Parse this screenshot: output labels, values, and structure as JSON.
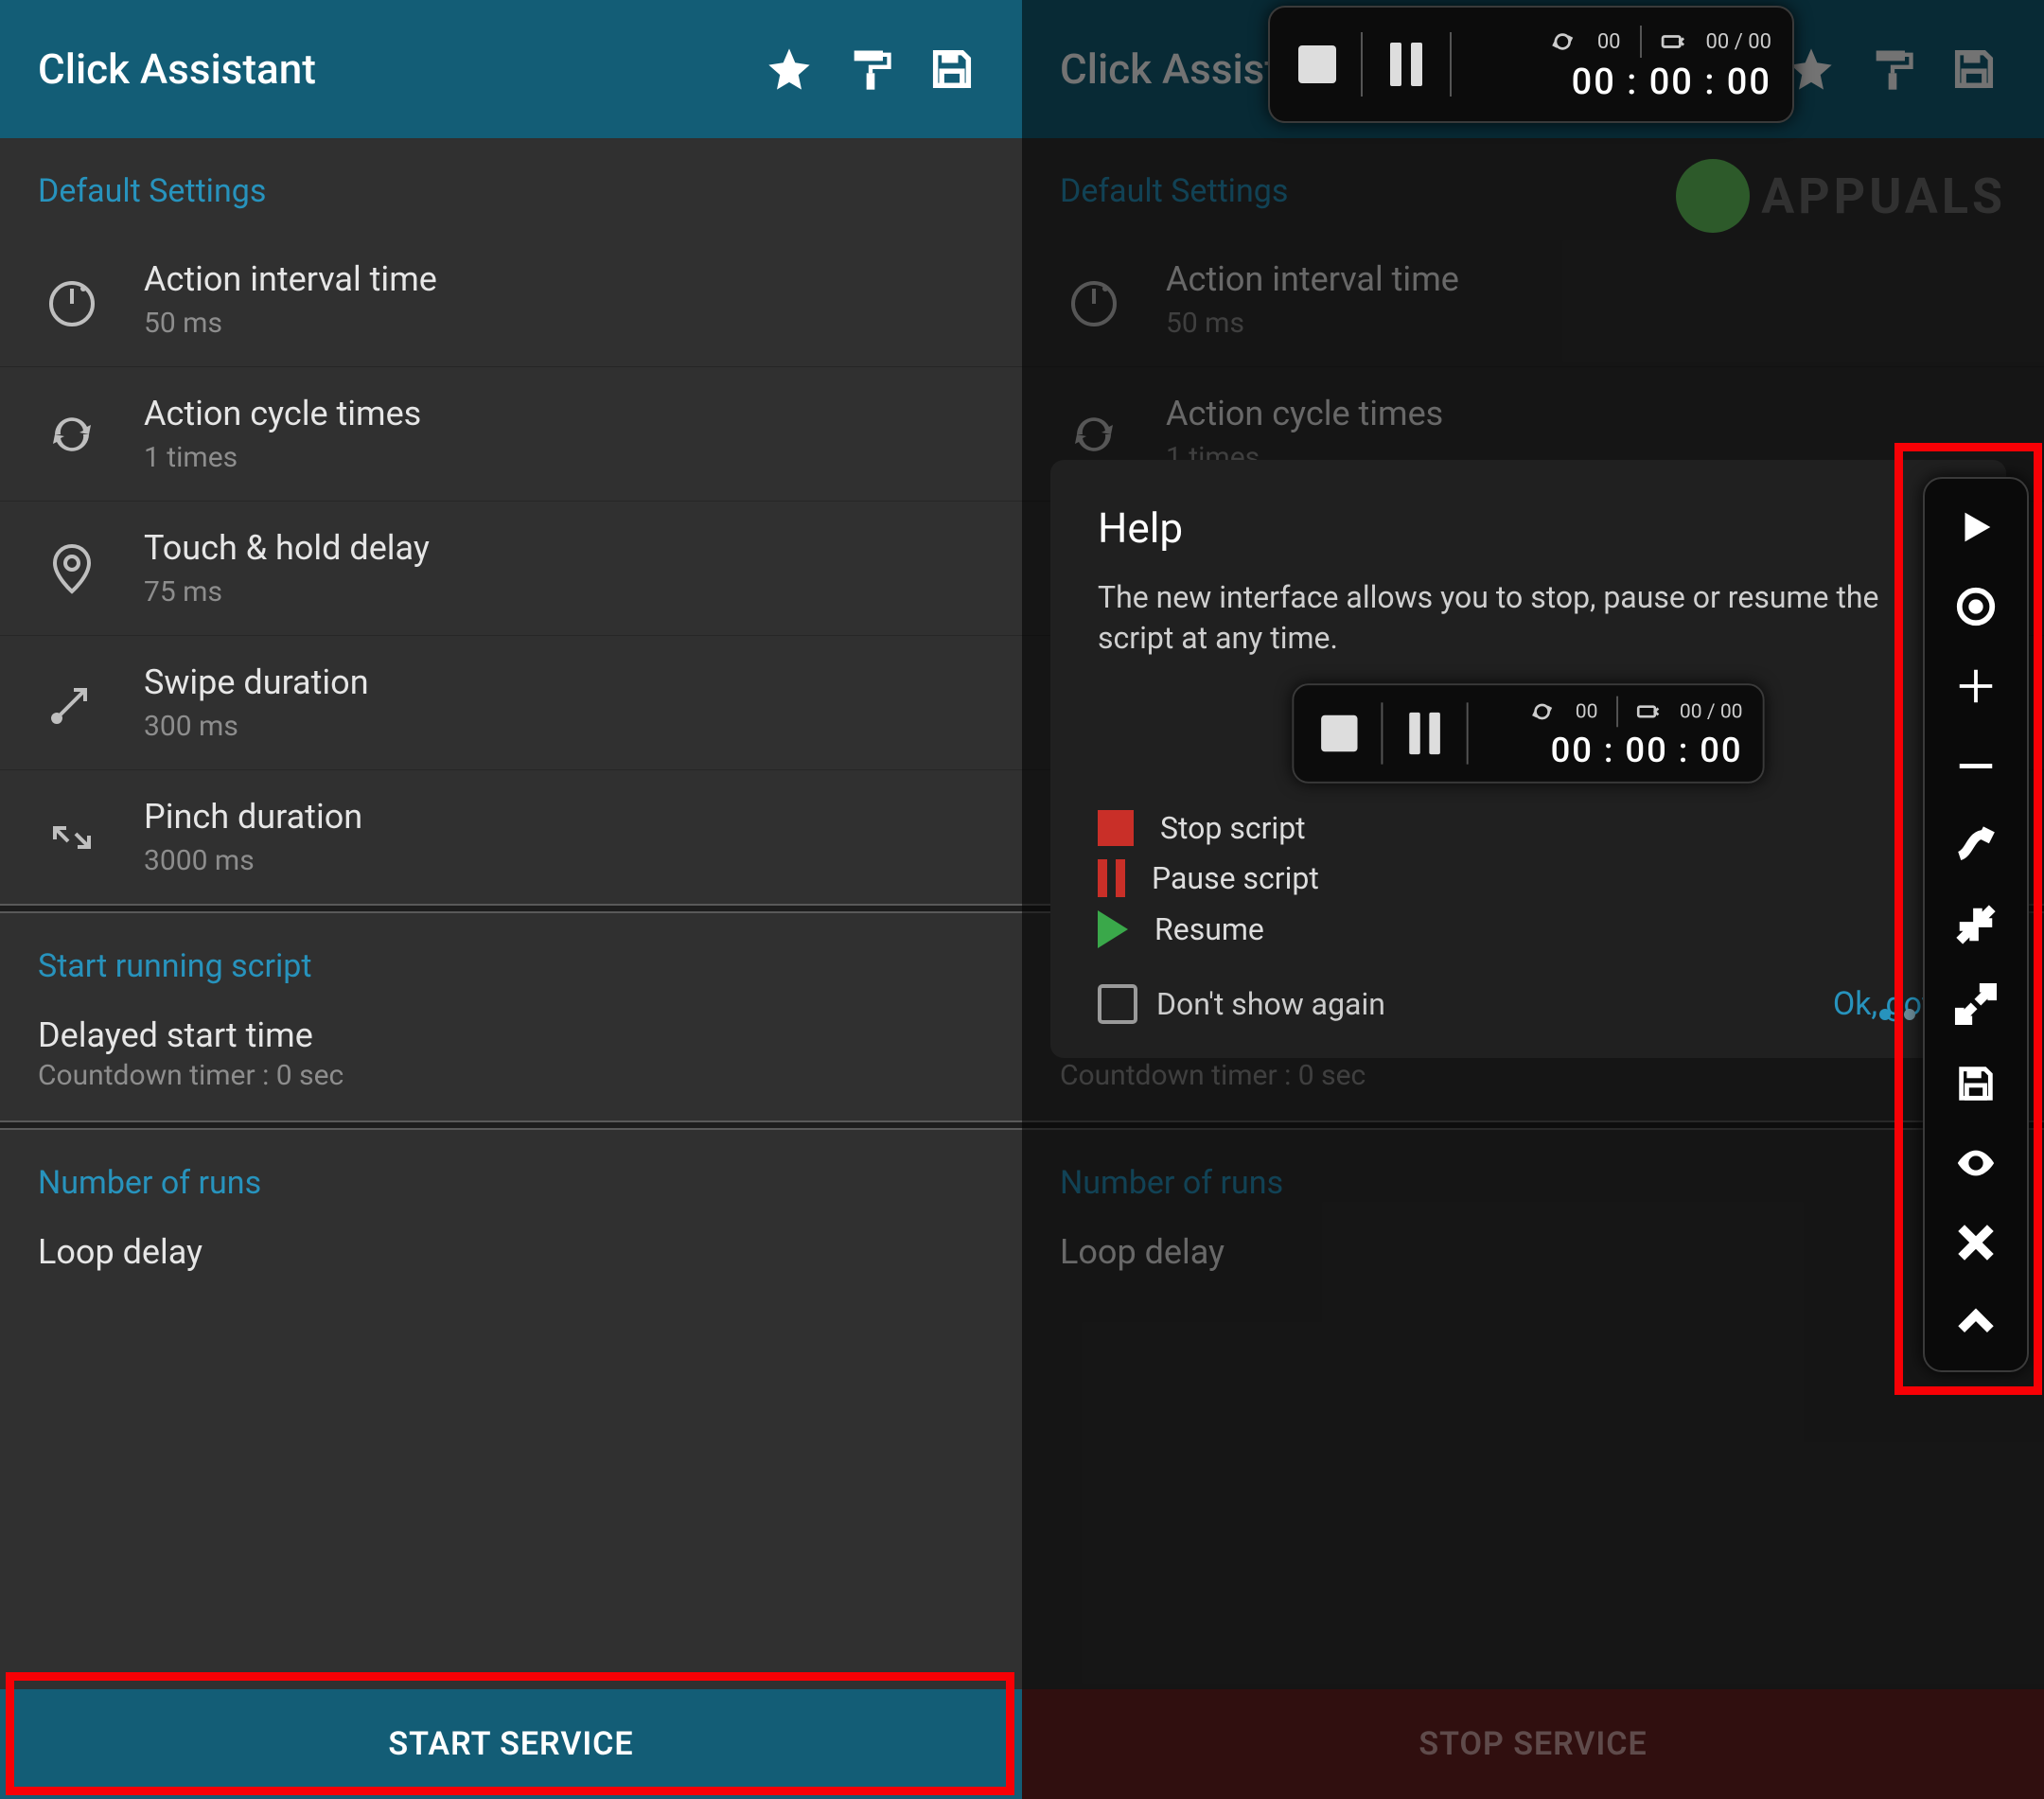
{
  "app_title": "Click Assistant",
  "sections": {
    "default_settings": "Default Settings",
    "start_running": "Start running script",
    "number_of_runs": "Number of runs"
  },
  "settings": {
    "interval": {
      "label": "Action interval time",
      "value": "50 ms"
    },
    "cycle": {
      "label": "Action cycle times",
      "value": "1 times"
    },
    "hold": {
      "label": "Touch & hold delay",
      "value": "75 ms"
    },
    "swipe": {
      "label": "Swipe duration",
      "value": "300 ms"
    },
    "pinch": {
      "label": "Pinch duration",
      "value": "3000 ms"
    }
  },
  "delayed": {
    "label": "Delayed start time",
    "sub": "Countdown timer : 0 sec"
  },
  "loop_delay_label": "Loop delay",
  "buttons": {
    "start": "START SERVICE",
    "stop": "STOP SERVICE"
  },
  "widget": {
    "loop_count": "00",
    "progress": "00 / 00",
    "timer": "00 : 00 : 00"
  },
  "help": {
    "title": "Help",
    "body": "The new interface allows you to stop, pause or resume the script at any time.",
    "stop": "Stop script",
    "pause": "Pause script",
    "resume": "Resume",
    "dont_show": "Don't show again",
    "ok": "Ok, got it"
  },
  "watermark": "APPUALS"
}
